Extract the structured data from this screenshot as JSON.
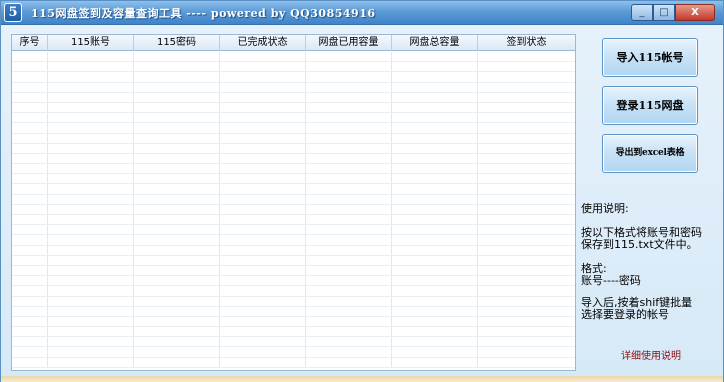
{
  "window": {
    "icon_text": "5",
    "title": "115网盘签到及容量查询工具 ---- powered by QQ30854916",
    "minimize_glyph": "_",
    "maximize_glyph": "□",
    "close_glyph": "X"
  },
  "grid": {
    "columns": [
      "序号",
      "115账号",
      "115密码",
      "已完成状态",
      "网盘已用容量",
      "网盘总容量",
      "签到状态"
    ],
    "rows": []
  },
  "actions": {
    "import_label": "导入115帐号",
    "login_label": "登录115网盘",
    "export_label": "导出到excel表格"
  },
  "help": {
    "heading": "使用说明:",
    "line1": "按以下格式将账号和密码\n保存到115.txt文件中。",
    "line2": "格式:\n账号----密码",
    "line3": "导入后,按着shif键批量\n选择要登录的帐号",
    "link": "详细使用说明"
  },
  "colors": {
    "titlebar": "#4a8ccf",
    "window_bg": "#dcecf8",
    "link": "#8a1010"
  }
}
